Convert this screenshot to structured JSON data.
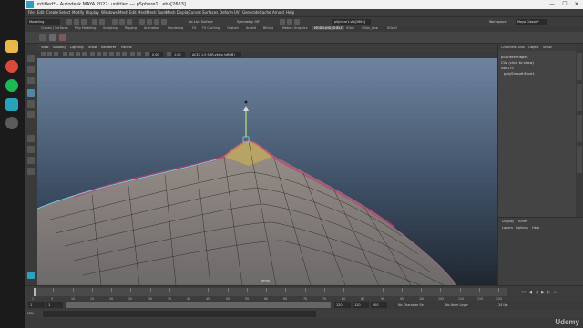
{
  "taskbar": {
    "icons": [
      "file-explorer-icon",
      "chrome-icon",
      "spotify-icon",
      "maya-taskbar-icon",
      "obs-icon"
    ]
  },
  "window": {
    "title": "untitled* - Autodesk MAYA 2022: untitled   ---   pSphere1...ehs[2663]",
    "minimize": "—",
    "maximize": "☐",
    "close": "✕"
  },
  "menubar": {
    "items": [
      "File",
      "Edit",
      "Create",
      "Select",
      "Modify",
      "Display",
      "Windows",
      "Mesh",
      "Edit Mesh",
      "Mesh Tools",
      "Mesh Display",
      "Curves",
      "Surfaces",
      "Deform",
      "UV",
      "Generate",
      "Cache",
      "Arnold",
      "Help"
    ]
  },
  "statusline": {
    "mode": "Modeling",
    "no_live_surface": "No Live Surface",
    "symmetry": "Symmetry: Off",
    "object_name": "pSphere1.vtx[2663]",
    "workspace_label": "Workspace:",
    "workspace_value": "Maya Classic*"
  },
  "shelf": {
    "tabs": [
      "Curves / Surfaces",
      "Poly Modeling",
      "Sculpting",
      "Rigging",
      "Animation",
      "Rendering",
      "FX",
      "FX Caching",
      "Custom",
      "Arnold",
      "Bifrost",
      "Motion Graphics",
      "MODELING_SHELF",
      "XGen",
      "XGen_Live",
      "XGen2"
    ],
    "active_tab": "MODELING_SHELF"
  },
  "viewport": {
    "menu": [
      "View",
      "Shading",
      "Lighting",
      "Show",
      "Renderer",
      "Panels"
    ],
    "field_exposure": "0.00",
    "field_gamma": "1.00",
    "color_space": "ACES 1.0 SDR-video (sRGB)",
    "camera_label": "persp"
  },
  "channelbox": {
    "menu": [
      "Channels",
      "Edit",
      "Object",
      "Show"
    ],
    "lines": [
      "pSphereShape1",
      "CVs (click to show)",
      "INPUTS",
      "polySmoothFace1"
    ],
    "layer_tabs": [
      "Display",
      "Anim"
    ],
    "layer_menu": [
      "Layers",
      "Options",
      "Help"
    ]
  },
  "timeslider": {
    "ticks": [
      "1",
      "5",
      "10",
      "15",
      "20",
      "25",
      "30",
      "35",
      "40",
      "45",
      "50",
      "55",
      "60",
      "65",
      "70",
      "75",
      "80",
      "85",
      "90",
      "95",
      "100",
      "105",
      "110",
      "115",
      "120"
    ],
    "current_frame": "1"
  },
  "rangeslider": {
    "start": "1",
    "start_inner": "1",
    "end_inner": "120",
    "end": "120",
    "end_outer": "200",
    "character_set": "No Character Set",
    "anim_layer": "No Anim Layer",
    "fps": "24 fps"
  },
  "cmdline": {
    "label": "MEL"
  },
  "watermark": "Udemy"
}
